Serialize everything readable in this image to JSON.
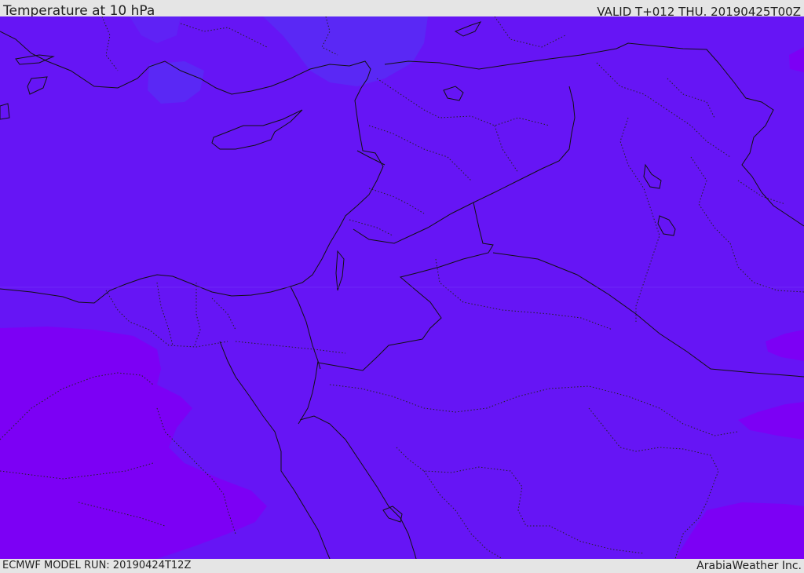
{
  "header": {
    "title": "Temperature at 10 hPa",
    "valid_time": "VALID T+012 THU. 20190425T00Z"
  },
  "footer": {
    "model_run": "ECMWF MODEL RUN: 20190424T12Z",
    "credit": "ArabiaWeather Inc."
  },
  "colors": {
    "base_field": "#6615f5",
    "warm_field": "#7c00f5",
    "cool_field": "#5a28f5",
    "borders": "#111111"
  }
}
